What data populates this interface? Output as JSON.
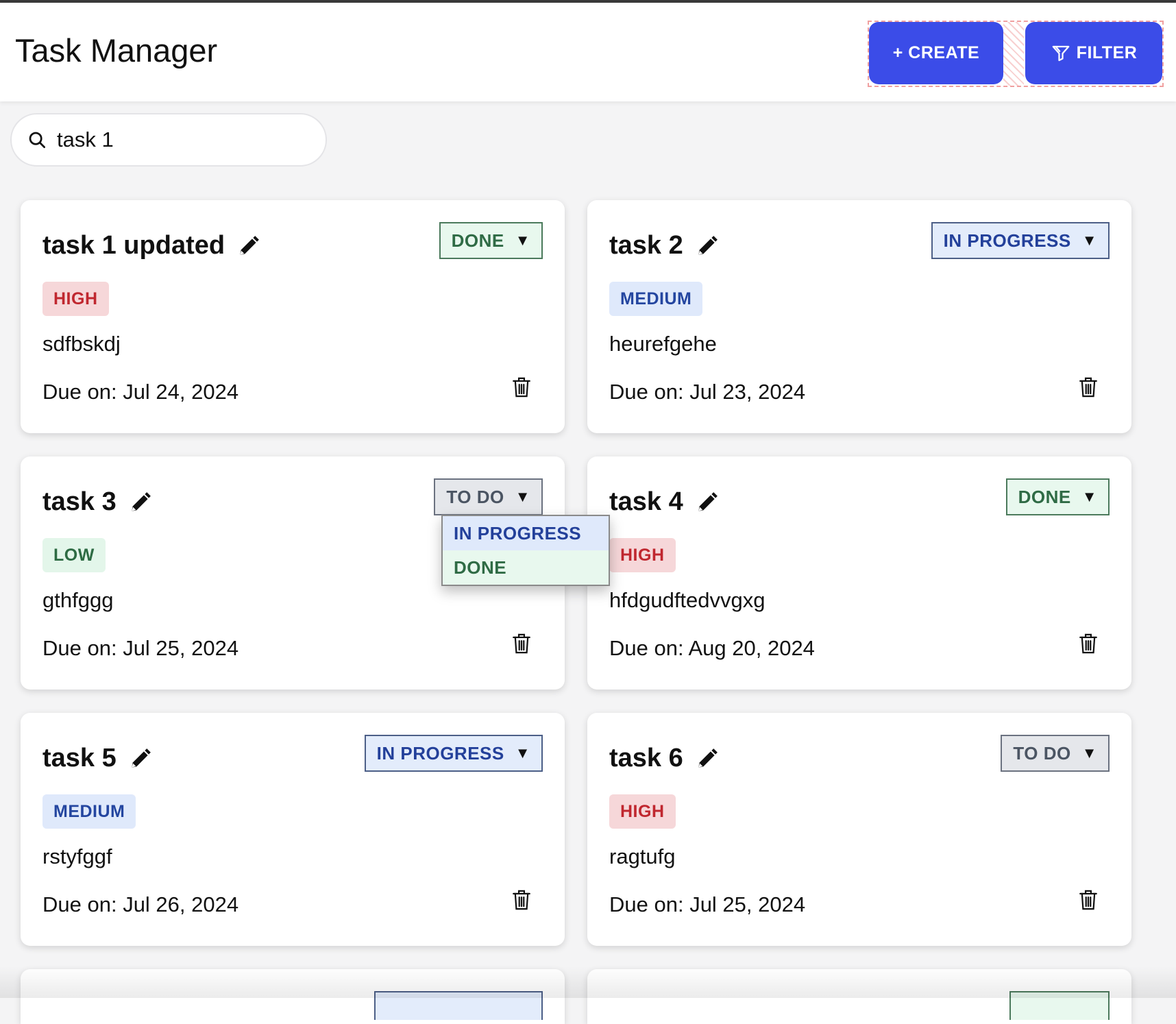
{
  "header": {
    "title": "Task Manager",
    "create_label": "+ CREATE",
    "filter_label": "FILTER"
  },
  "search": {
    "value": "task 1",
    "icon": "search-icon"
  },
  "tasks": [
    {
      "title": "task 1 updated",
      "status": "DONE",
      "priority": "HIGH",
      "description": "sdfbskdj",
      "due": "Due on: Jul 24, 2024"
    },
    {
      "title": "task 2",
      "status": "IN PROGRESS",
      "priority": "MEDIUM",
      "description": "heurefgehe",
      "due": "Due on: Jul 23, 2024"
    },
    {
      "title": "task 3",
      "status": "TO DO",
      "priority": "LOW",
      "description": "gthfggg",
      "due": "Due on: Jul 25, 2024"
    },
    {
      "title": "task 4",
      "status": "DONE",
      "priority": "HIGH",
      "description": "hfdgudftedvvgxg",
      "due": "Due on: Aug 20, 2024"
    },
    {
      "title": "task 5",
      "status": "IN PROGRESS",
      "priority": "MEDIUM",
      "description": "rstyfggf",
      "due": "Due on: Jul 26, 2024"
    },
    {
      "title": "task 6",
      "status": "TO DO",
      "priority": "HIGH",
      "description": "ragtufg",
      "due": "Due on: Jul 25, 2024"
    }
  ],
  "status_dropdown": {
    "open_on_task": "task 3",
    "options": [
      "IN PROGRESS",
      "DONE"
    ]
  },
  "colors": {
    "accent": "#3b4ce8",
    "done_bg": "#e8f8ee",
    "inprogress_bg": "#e3ecfb",
    "todo_bg": "#e5e7eb",
    "high_bg": "#f6d7d9",
    "medium_bg": "#dfe9fb",
    "low_bg": "#e3f6ea"
  }
}
